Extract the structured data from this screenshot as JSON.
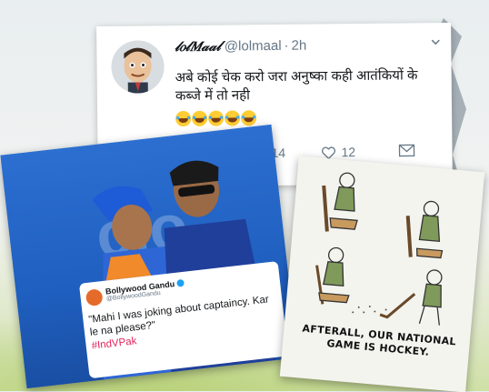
{
  "tweet": {
    "name": "𝓁𝑜𝓁𝑀𝒶𝒶𝓁",
    "handle": "@lolmaal",
    "separator": "·",
    "time": "2h",
    "text": "अबे कोई चेक करो जरा अनुष्का कही आतंकियों के कब्जे में तो नही",
    "emoji": "😂😂😂😂😂",
    "retweets": "14",
    "likes": "12"
  },
  "photo_card": {
    "watermark": "clo",
    "embedded_tweet": {
      "name": "Bollywood Gandu",
      "handle": "@BollywoodGandu",
      "text": "\"Mahi I was joking about captaincy. Kar le na please?\"",
      "hashtag": "#IndVPak"
    }
  },
  "cartoon_card": {
    "caption": "AFTERALL, OUR NATIONAL GAME IS HOCKEY."
  },
  "colors": {
    "tweet_text": "#14171a",
    "muted": "#657786",
    "hashtag": "#e0245e",
    "photo_blue": "#1f5fbf"
  }
}
